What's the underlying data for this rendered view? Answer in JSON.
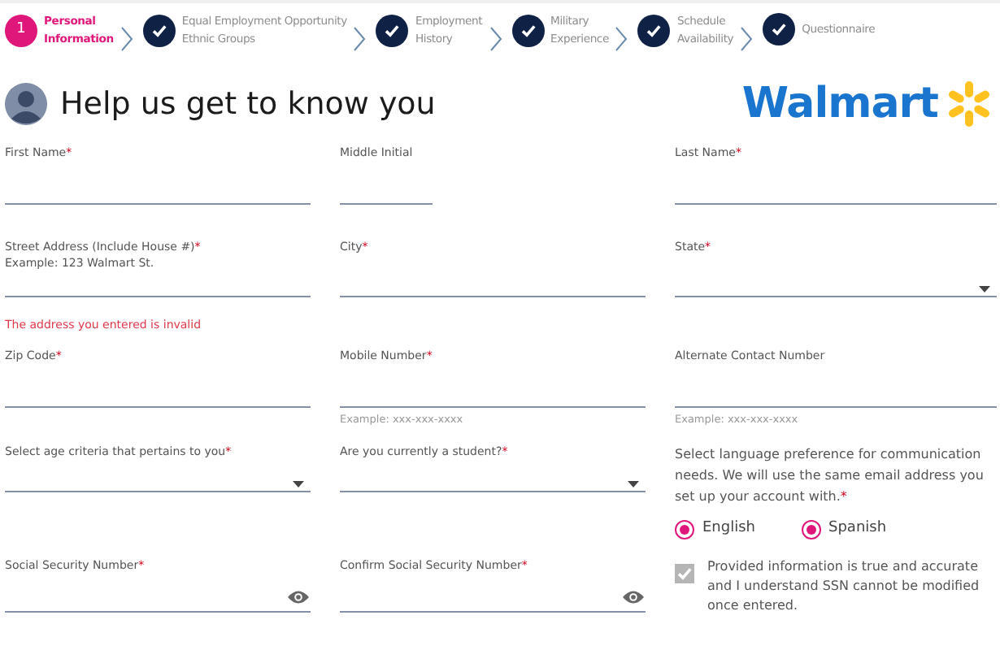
{
  "steps": [
    {
      "number": "1",
      "label": [
        "Personal",
        "Information"
      ],
      "selected": true,
      "completed": false
    },
    {
      "label": [
        "Equal Employment Opportunity",
        "Ethnic Groups"
      ],
      "selected": false,
      "completed": true
    },
    {
      "label": [
        "Employment",
        "History"
      ],
      "selected": false,
      "completed": true
    },
    {
      "label": [
        "Military",
        "Experience"
      ],
      "selected": false,
      "completed": true
    },
    {
      "label": [
        "Schedule",
        "Availability"
      ],
      "selected": false,
      "completed": true
    },
    {
      "label": [
        "Questionnaire"
      ],
      "selected": false,
      "completed": true
    }
  ],
  "header": {
    "title": "Help us get to know you",
    "logo": "Walmart"
  },
  "rows": [
    {
      "cells": [
        {
          "kind": "text",
          "label": "First Name",
          "required_mark": "*"
        },
        {
          "kind": "initial",
          "label": "Middle Initial"
        },
        {
          "kind": "text",
          "label": "Last Name",
          "required_mark": "*"
        }
      ]
    },
    {
      "cells": [
        {
          "kind": "text",
          "label": "Street Address (Include House #)",
          "required_mark": "*",
          "sublabel": "Example: 123 Walmart St.",
          "error": "The address you entered is invalid"
        },
        {
          "kind": "text",
          "label": "City",
          "required_mark": "*"
        },
        {
          "kind": "select",
          "label": "State",
          "required_mark": "*"
        }
      ]
    },
    {
      "cells": [
        {
          "kind": "text",
          "label": "Zip Code",
          "required_mark": "*"
        },
        {
          "kind": "text",
          "label": "Mobile Number",
          "required_mark": "*",
          "hint": "Example: xxx-xxx-xxxx"
        },
        {
          "kind": "text",
          "label": "Alternate Contact Number",
          "hint": "Example: xxx-xxx-xxxx"
        }
      ]
    },
    {
      "cells": [
        {
          "kind": "select",
          "label": "Select age criteria that pertains to you",
          "required_mark": "*"
        },
        {
          "kind": "select",
          "label": "Are you currently a student?",
          "required_mark": "*"
        },
        {
          "kind": "radios",
          "label": "Select language preference for communication needs. We will use the same email address you set up your account with.",
          "required_mark": "*",
          "options": [
            {
              "label": "English",
              "selected": true
            },
            {
              "label": "Spanish",
              "selected": true
            }
          ]
        }
      ]
    },
    {
      "cells": [
        {
          "kind": "secret",
          "label": "Social Security Number",
          "required_mark": "*"
        },
        {
          "kind": "secret",
          "label": "Confirm Social Security Number",
          "required_mark": "*"
        },
        {
          "kind": "checkbox",
          "label": "Provided information is true and accurate and I understand SSN cannot be modified once entered.",
          "checked": true,
          "disabled": true
        }
      ]
    }
  ]
}
